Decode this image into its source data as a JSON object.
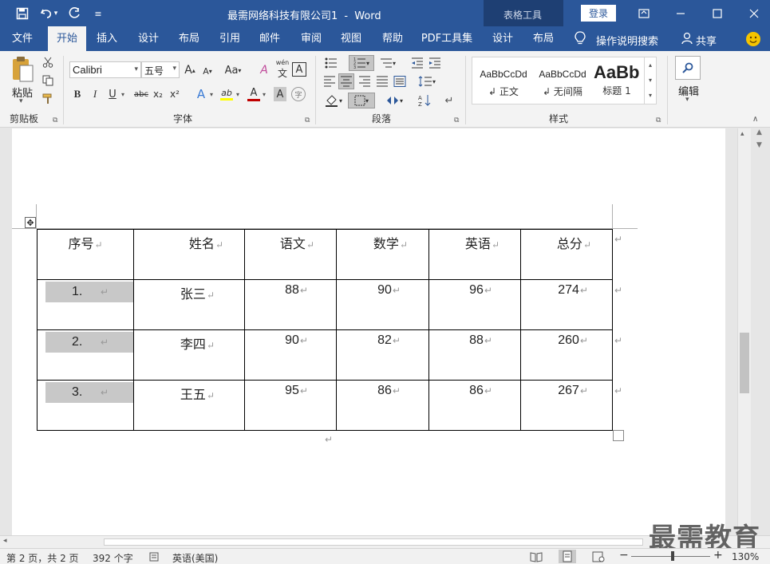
{
  "window": {
    "title": "最需网络科技有限公司1",
    "separator": "-",
    "app": "Word",
    "context_group": "表格工具",
    "login": "登录"
  },
  "tabs": [
    {
      "label": "文件",
      "active": false
    },
    {
      "label": "开始",
      "active": true
    },
    {
      "label": "插入",
      "active": false
    },
    {
      "label": "设计",
      "active": false
    },
    {
      "label": "布局",
      "active": false
    },
    {
      "label": "引用",
      "active": false
    },
    {
      "label": "邮件",
      "active": false
    },
    {
      "label": "审阅",
      "active": false
    },
    {
      "label": "视图",
      "active": false
    },
    {
      "label": "帮助",
      "active": false
    },
    {
      "label": "PDF工具集",
      "active": false
    },
    {
      "label": "设计",
      "active": false
    },
    {
      "label": "布局",
      "active": false
    }
  ],
  "tellme": "操作说明搜索",
  "share": "共享",
  "ribbon": {
    "clipboard": {
      "label": "剪贴板",
      "paste": "粘贴"
    },
    "font": {
      "label": "字体",
      "name": "Calibri",
      "size": "五号",
      "bold": "B",
      "italic": "I",
      "underline": "U",
      "strike": "abc",
      "sub": "x₂",
      "sup": "x²",
      "grow": "A",
      "shrink": "A",
      "case": "Aa",
      "clear": "A",
      "phonetic": "wén",
      "border": "A",
      "effects": "A",
      "highlight": "ab",
      "color": "A",
      "shade": "A",
      "enclose": "字"
    },
    "paragraph": {
      "label": "段落"
    },
    "styles": {
      "label": "样式",
      "items": [
        {
          "preview": "AaBbCcDd",
          "name": "正文"
        },
        {
          "preview": "AaBbCcDd",
          "name": "无间隔"
        },
        {
          "preview": "AaBb",
          "name": "标题 1"
        }
      ]
    },
    "editing": {
      "label": "编辑"
    }
  },
  "table": {
    "headers": [
      "序号",
      "姓名",
      "语文",
      "数学",
      "英语",
      "总分"
    ],
    "rows": [
      [
        "1.",
        "张三",
        "88",
        "90",
        "96",
        "274"
      ],
      [
        "2.",
        "李四",
        "90",
        "82",
        "88",
        "260"
      ],
      [
        "3.",
        "王五",
        "95",
        "86",
        "86",
        "267"
      ]
    ]
  },
  "marks": {
    "paragraph": "↵"
  },
  "status": {
    "page": "第 2 页，共 2 页",
    "words": "392 个字",
    "language": "英语(美国)",
    "zoom": "130%",
    "zoom_minus": "−",
    "zoom_plus": "+"
  },
  "watermark": "最需教育",
  "colors": {
    "brand": "#2b579a",
    "accent_red": "#c00000",
    "highlight": "#ffff00"
  }
}
